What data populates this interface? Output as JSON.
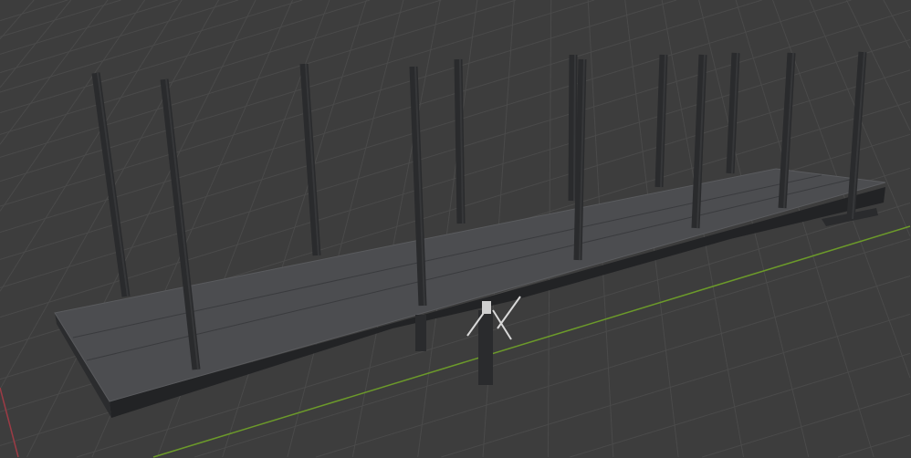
{
  "viewport": {
    "background_color": "#3d3d3d",
    "grid_color": "#4a4a4a",
    "x_axis_color": "#9c3b45",
    "y_axis_color": "#6c9a2a"
  },
  "object": {
    "deck_color": "#4c4d50",
    "frame_color": "#222325",
    "post_color": "#2a2b2d",
    "post_count": 12
  }
}
